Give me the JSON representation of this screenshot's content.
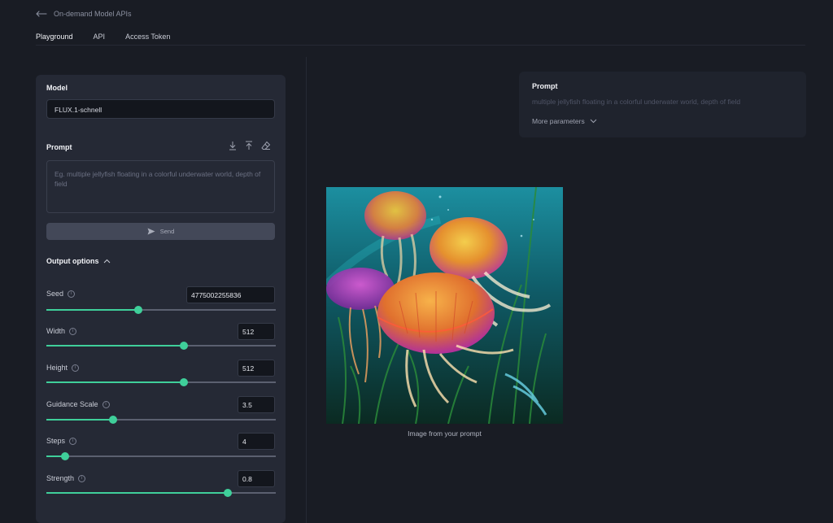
{
  "nav": {
    "back_label": "On-demand Model APIs"
  },
  "tabs": [
    {
      "label": "Playground",
      "active": true
    },
    {
      "label": "API",
      "active": false
    },
    {
      "label": "Access Token",
      "active": false
    }
  ],
  "left": {
    "model_label": "Model",
    "model_value": "FLUX.1-schnell",
    "prompt_label": "Prompt",
    "prompt_placeholder": "Eg. multiple jellyfish floating in a colorful underwater world, depth of field",
    "send_label": "Send",
    "output_options_label": "Output options",
    "params": [
      {
        "label": "Seed",
        "value": "4775002255836",
        "fraction": 0.4
      },
      {
        "label": "Width",
        "value": "512",
        "fraction": 0.6
      },
      {
        "label": "Height",
        "value": "512",
        "fraction": 0.6
      },
      {
        "label": "Guidance Scale",
        "value": "3.5",
        "fraction": 0.29
      },
      {
        "label": "Steps",
        "value": "4",
        "fraction": 0.08
      },
      {
        "label": "Strength",
        "value": "0.8",
        "fraction": 0.79
      }
    ]
  },
  "right": {
    "prompt_title": "Prompt",
    "prompt_text": "multiple jellyfish floating in a colorful underwater world, depth of field",
    "more_params_label": "More parameters",
    "image_caption": "Image from your prompt"
  },
  "colors": {
    "accent": "#3fcf9a",
    "background": "#191c24",
    "panel": "#252935"
  }
}
